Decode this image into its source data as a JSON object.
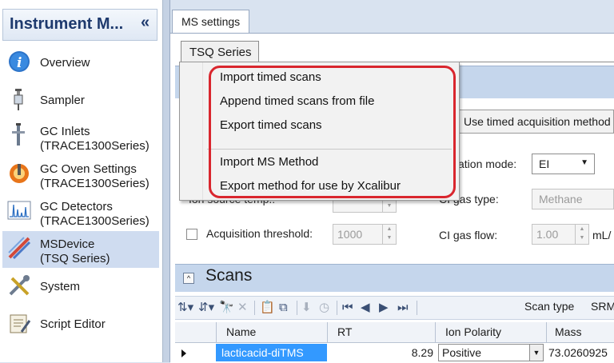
{
  "nav": {
    "title": "Instrument M...",
    "collapse": "«",
    "items": [
      {
        "line1": "Overview",
        "line2": ""
      },
      {
        "line1": "Sampler",
        "line2": ""
      },
      {
        "line1": "GC Inlets",
        "line2": "(TRACE1300Series)"
      },
      {
        "line1": "GC Oven Settings",
        "line2": "(TRACE1300Series)"
      },
      {
        "line1": "GC Detectors",
        "line2": "(TRACE1300Series)"
      },
      {
        "line1": "MSDevice",
        "line2": "(TSQ Series)"
      },
      {
        "line1": "System",
        "line2": ""
      },
      {
        "line1": "Script Editor",
        "line2": ""
      }
    ]
  },
  "document_tab": "MS settings",
  "series_tab": "TSQ Series",
  "menu": {
    "items": [
      "Import timed scans",
      "Append timed scans from file",
      "Export timed scans",
      "Import MS Method",
      "Export method for use by Xcalibur"
    ]
  },
  "settings": {
    "timed_acquisition_button": "Use timed acquisition method",
    "ionization_mode_label": "zation mode:",
    "ionization_mode_value": "EI",
    "ion_source_temp_label": "Ion source temp.:",
    "ci_gas_type_label": "CI gas type:",
    "ci_gas_type_value": "Methane",
    "acquisition_threshold_label": "Acquisition threshold:",
    "acquisition_threshold_value": "1000",
    "ci_gas_flow_label": "CI gas flow:",
    "ci_gas_flow_value": "1.00",
    "ci_gas_flow_unit": "mL/"
  },
  "scans": {
    "title": "Scans",
    "toggle_symbol": "^",
    "scan_type_label": "Scan type",
    "scan_type_value": "SRM",
    "columns": [
      "Name",
      "RT",
      "Ion Polarity",
      "Mass"
    ],
    "rows": [
      {
        "name": "lacticacid-diTMS",
        "rt": "8.29",
        "polarity": "Positive",
        "mass": "73.0260925"
      }
    ]
  },
  "colors": {
    "highlight": "#d9262e",
    "selection": "#3399ff",
    "band": "#c5d6ec"
  }
}
